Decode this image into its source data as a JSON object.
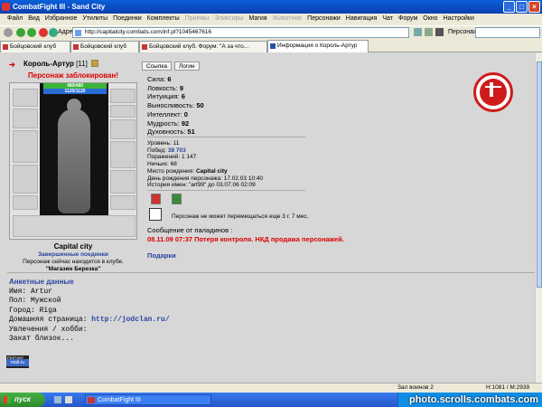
{
  "window": {
    "title": "CombatFight III - Sand City"
  },
  "menu": [
    {
      "label": "Файл",
      "disabled": false
    },
    {
      "label": "Вид",
      "disabled": false
    },
    {
      "label": "Избранное",
      "disabled": false
    },
    {
      "label": "Утилиты",
      "disabled": false
    },
    {
      "label": "Поединки",
      "disabled": false
    },
    {
      "label": "Комплекты",
      "disabled": false
    },
    {
      "label": "Приёмы",
      "disabled": true
    },
    {
      "label": "Эликсиры",
      "disabled": true
    },
    {
      "label": "Магия",
      "disabled": false
    },
    {
      "label": "Животное",
      "disabled": true
    },
    {
      "label": "Персонажи",
      "disabled": false
    },
    {
      "label": "Навигация",
      "disabled": false
    },
    {
      "label": "Чат",
      "disabled": false
    },
    {
      "label": "Форум",
      "disabled": false
    },
    {
      "label": "Окно",
      "disabled": false
    },
    {
      "label": "Настройки",
      "disabled": false
    }
  ],
  "address": {
    "label": "Адрес:",
    "url": "http://capitalcity.combats.com/inf.pl?1045467616",
    "persona_label": "Персонаж:"
  },
  "tabs": [
    {
      "label": "Бойцовский клуб",
      "active": false
    },
    {
      "label": "Бойцовский клуб",
      "active": false
    },
    {
      "label": "Бойцовский клуб. Форум: \"А за что...",
      "active": false
    },
    {
      "label": "Информация о Король-Артур",
      "active": true
    }
  ],
  "character": {
    "name": "Король-Артур",
    "level": "[11]",
    "blocked": "Персонаж заблокирован!",
    "hp": "480/480",
    "mana": "1120/1120",
    "city": "Capital city",
    "fights_link": "Завершенные поединки",
    "location": "Персонаж сейчас находится в клубе.",
    "room": "\"Магазин Березка\""
  },
  "buttons": {
    "link": "Ссылка",
    "login": "Логин"
  },
  "stats": [
    {
      "label": "Сила:",
      "value": "6"
    },
    {
      "label": "Ловкость:",
      "value": "9"
    },
    {
      "label": "Интуиция:",
      "value": "6"
    },
    {
      "label": "Выносливость:",
      "value": "50"
    },
    {
      "label": "Интеллект:",
      "value": "0"
    },
    {
      "label": "Мудрость:",
      "value": "92"
    },
    {
      "label": "Духовность:",
      "value": "51"
    }
  ],
  "info": {
    "level": "Уровень: 11",
    "wins_label": "Побед: ",
    "wins": "38 703",
    "losses": "Поражений: 1 147",
    "draws": "Ничьих: 68",
    "birthplace_label": "Место рождения: ",
    "birthplace": "Capital city",
    "birthday": "День рождения персонажа: 17.02.03 10:40",
    "names_history": "История имен: \"art99\" до 03.07.06 02:09"
  },
  "move_note": "Персонаж не может перемещаться еще 3 г. 7 мес.",
  "paladins": {
    "header": "Сообщение от паладинов :",
    "message": "08.11.09 07:37 Потеря контроля. НКД продажа персонажей."
  },
  "gifts": "Подарки",
  "anketa": {
    "header": "Анкетные данные",
    "name": "Имя: Artur",
    "gender": "Пол: Мужской",
    "city": "Город: Riga",
    "homepage_label": "Домашняя страница: ",
    "homepage": "http://jodclan.ru/",
    "hobby": "Увлечения / хобби:",
    "hobby_text": "Закат близок..."
  },
  "counter": {
    "top": "РЕЙТИНГ 0015786842",
    "site": "mail.ru"
  },
  "statusbar": {
    "left": "Зал воинов 2",
    "mid": "H:1081 / M:2939"
  },
  "taskbar": {
    "start": "пуск",
    "task": "CombatFight III"
  },
  "watermark": "photo.scrolls.combats.com",
  "colors": {
    "accent": "#d01a1a",
    "link": "#2a44a0",
    "bg": "#d7d7d7"
  }
}
